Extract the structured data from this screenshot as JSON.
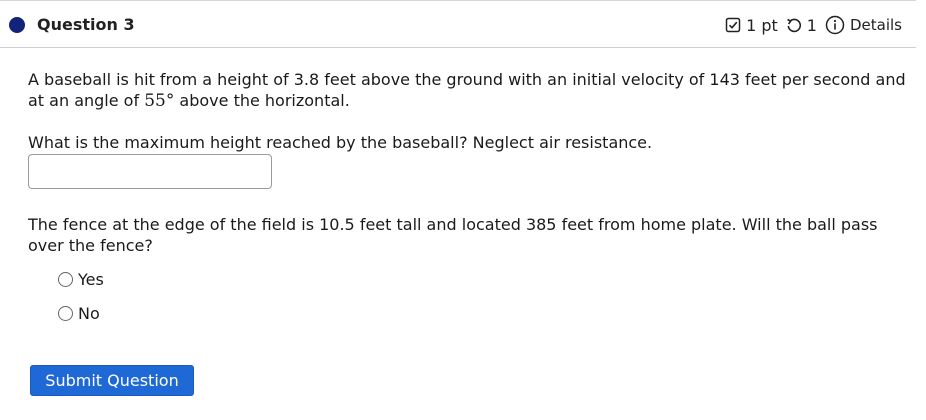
{
  "question": {
    "title": "Question 3",
    "points": "1 pt",
    "attempts": "1",
    "details_label": "Details"
  },
  "problem": {
    "intro_before_angle": "A baseball is hit from a height of 3.8 feet above the ground with an initial velocity of 143 feet per second and at an angle of ",
    "angle": "55°",
    "intro_after_angle": " above the horizontal.",
    "part1_prompt": "What is the maximum height reached by the baseball? Neglect air resistance.",
    "part1_answer_value": "",
    "part2_prompt": "The fence at the edge of the field is 10.5 feet tall and located 385 feet from home plate. Will the ball pass over the fence?",
    "options": [
      "Yes",
      "No"
    ]
  },
  "submit_label": "Submit Question",
  "colors": {
    "question_dot": "#13237a",
    "submit_button": "#1f69d6"
  },
  "icons": {
    "points": "checkbox-icon",
    "attempts": "retry-icon",
    "details": "info-icon"
  }
}
